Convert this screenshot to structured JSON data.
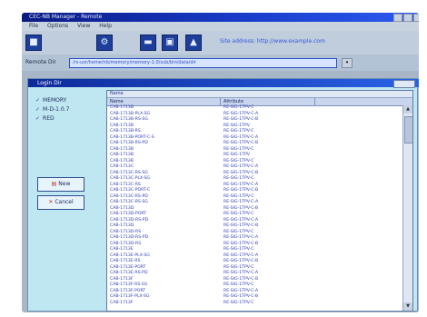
{
  "window": {
    "title": "CEC-NB Manager - Remote"
  },
  "menu": [
    "File",
    "Options",
    "View",
    "Help"
  ],
  "toolbar": {
    "status_text": "Site address: http://www.example.com"
  },
  "address": {
    "label": "Remote Dir",
    "value": "/rs-usr/home/nb/memory/memory-1.0/sub/bin/data/dir"
  },
  "dialog": {
    "title": "Login Dir",
    "tree": [
      {
        "mark": "✓",
        "label": "MEMORY"
      },
      {
        "mark": "✓",
        "label": "M-D-1.0.7"
      },
      {
        "mark": "✓",
        "label": "RED"
      }
    ],
    "buttons": {
      "new": "New",
      "cancel": "Cancel"
    },
    "list": {
      "caption": "Name",
      "col_name": "Name",
      "col_attr": "Attribute",
      "rows": [
        {
          "name": "CAB-1713B",
          "attr": "RE-SIG-1TPV-C"
        },
        {
          "name": "CAB-1713B-PLX-SG",
          "attr": "RE-SIG-1TPV-C-A"
        },
        {
          "name": "CAB-1713B-RS-SG",
          "attr": "RE-SIG-1TPV-C-B"
        },
        {
          "name": "CAB-1713B",
          "attr": "RE-SIG-1TPV"
        },
        {
          "name": "CAB-1713B-RS",
          "attr": "RE-SIG-1TPV-C"
        },
        {
          "name": "CAB-1713B-PORT-C-S",
          "attr": "RE-SIG-1TPV-C-A"
        },
        {
          "name": "CAB-1713B-RS-PD",
          "attr": "RE-SIG-1TPV-C-B"
        },
        {
          "name": "CAB-1713B",
          "attr": "RE-SIG-1TPV-C"
        },
        {
          "name": "CAB-1713B",
          "attr": "RE-SIG-1TPV"
        },
        {
          "name": "CAB-1713B",
          "attr": "RE-SIG-1TPV-C"
        },
        {
          "name": "CAB-1713C",
          "attr": "RE-SIG-1TPV-C-A"
        },
        {
          "name": "CAB-1713C-RS-SG",
          "attr": "RE-SIG-1TPV-C-B"
        },
        {
          "name": "CAB-1713C-PLX-SG",
          "attr": "RE-SIG-1TPV-C"
        },
        {
          "name": "CAB-1713C-RS",
          "attr": "RE-SIG-1TPV-C-A"
        },
        {
          "name": "CAB-1713C-PORT-C",
          "attr": "RE-SIG-1TPV-C-B"
        },
        {
          "name": "CAB-1713C-RS-PD",
          "attr": "RE-SIG-1TPV-C"
        },
        {
          "name": "CAB-1713C-RS-SG",
          "attr": "RE-SIG-1TPV-C-A"
        },
        {
          "name": "CAB-1713D",
          "attr": "RE-SIG-1TPV-C-B"
        },
        {
          "name": "CAB-1713D-PORT",
          "attr": "RE-SIG-1TPV-C"
        },
        {
          "name": "CAB-1713D-RS-PD",
          "attr": "RE-SIG-1TPV-C-A"
        },
        {
          "name": "CAB-1713D",
          "attr": "RE-SIG-1TPV-C-B"
        },
        {
          "name": "CAB-1713D-RS",
          "attr": "RE-SIG-1TPV-C"
        },
        {
          "name": "CAB-1713D-RS-PD",
          "attr": "RE-SIG-1TPV-C-A"
        },
        {
          "name": "CAB-1713D-RS",
          "attr": "RE-SIG-1TPV-C-B"
        },
        {
          "name": "CAB-1713E",
          "attr": "RE-SIG-1TPV-C"
        },
        {
          "name": "CAB-1713E-PLX-SG",
          "attr": "RE-SIG-1TPV-C-A"
        },
        {
          "name": "CAB-1713E-RS",
          "attr": "RE-SIG-1TPV-C-B"
        },
        {
          "name": "CAB-1713E-PORT",
          "attr": "RE-SIG-1TPV-C"
        },
        {
          "name": "CAB-1713E-RS-PD",
          "attr": "RE-SIG-1TPV-C-A"
        },
        {
          "name": "CAB-1713F",
          "attr": "RE-SIG-1TPV-C-B"
        },
        {
          "name": "CAB-1713F-RS-SG",
          "attr": "RE-SIG-1TPV-C"
        },
        {
          "name": "CAB-1713F-PORT",
          "attr": "RE-SIG-1TPV-C-A"
        },
        {
          "name": "CAB-1713F-PLX-SG",
          "attr": "RE-SIG-1TPV-C-B"
        },
        {
          "name": "CAB-1713F",
          "attr": "RE-SIG-1TPV-C"
        }
      ]
    }
  },
  "colors": {
    "titlebar": "#0a1a82",
    "dialog_bg": "#bfe7f2",
    "link_text": "#2e3fb5"
  }
}
